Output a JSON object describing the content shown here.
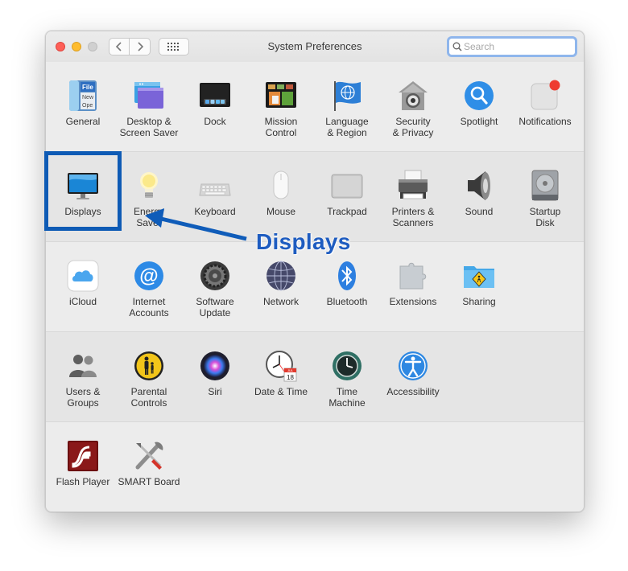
{
  "window": {
    "title": "System Preferences",
    "search_placeholder": "Search"
  },
  "annotation": {
    "label": "Displays",
    "color": "#1e5cc0"
  },
  "sections": [
    [
      {
        "name": "general",
        "label": "General",
        "icon": "general-icon"
      },
      {
        "name": "desktop-screen-saver",
        "label": "Desktop &\nScreen Saver",
        "icon": "desktop-icon"
      },
      {
        "name": "dock",
        "label": "Dock",
        "icon": "dock-icon"
      },
      {
        "name": "mission-control",
        "label": "Mission\nControl",
        "icon": "mission-control-icon"
      },
      {
        "name": "language-region",
        "label": "Language\n& Region",
        "icon": "flag-icon"
      },
      {
        "name": "security-privacy",
        "label": "Security\n& Privacy",
        "icon": "house-lock-icon"
      },
      {
        "name": "spotlight",
        "label": "Spotlight",
        "icon": "magnifier-icon"
      },
      {
        "name": "notifications",
        "label": "Notifications",
        "icon": "notifications-icon"
      }
    ],
    [
      {
        "name": "displays",
        "label": "Displays",
        "icon": "monitor-icon"
      },
      {
        "name": "energy-saver",
        "label": "Energy\nSaver",
        "icon": "lightbulb-icon"
      },
      {
        "name": "keyboard",
        "label": "Keyboard",
        "icon": "keyboard-icon"
      },
      {
        "name": "mouse",
        "label": "Mouse",
        "icon": "mouse-icon"
      },
      {
        "name": "trackpad",
        "label": "Trackpad",
        "icon": "trackpad-icon"
      },
      {
        "name": "printers-scanners",
        "label": "Printers &\nScanners",
        "icon": "printer-icon"
      },
      {
        "name": "sound",
        "label": "Sound",
        "icon": "speaker-icon"
      },
      {
        "name": "startup-disk",
        "label": "Startup\nDisk",
        "icon": "disk-icon"
      }
    ],
    [
      {
        "name": "icloud",
        "label": "iCloud",
        "icon": "cloud-icon"
      },
      {
        "name": "internet-accounts",
        "label": "Internet\nAccounts",
        "icon": "at-sign-icon"
      },
      {
        "name": "software-update",
        "label": "Software\nUpdate",
        "icon": "gear-icon"
      },
      {
        "name": "network",
        "label": "Network",
        "icon": "globe-icon"
      },
      {
        "name": "bluetooth",
        "label": "Bluetooth",
        "icon": "bluetooth-icon"
      },
      {
        "name": "extensions",
        "label": "Extensions",
        "icon": "puzzle-icon"
      },
      {
        "name": "sharing",
        "label": "Sharing",
        "icon": "sharing-folder-icon"
      }
    ],
    [
      {
        "name": "users-groups",
        "label": "Users &\nGroups",
        "icon": "users-icon"
      },
      {
        "name": "parental-controls",
        "label": "Parental\nControls",
        "icon": "parental-icon"
      },
      {
        "name": "siri",
        "label": "Siri",
        "icon": "siri-icon"
      },
      {
        "name": "date-time",
        "label": "Date & Time",
        "icon": "clock-calendar-icon"
      },
      {
        "name": "time-machine",
        "label": "Time\nMachine",
        "icon": "time-machine-icon"
      },
      {
        "name": "accessibility",
        "label": "Accessibility",
        "icon": "accessibility-icon"
      }
    ],
    [
      {
        "name": "flash-player",
        "label": "Flash Player",
        "icon": "flash-icon"
      },
      {
        "name": "smart-board",
        "label": "SMART Board",
        "icon": "tools-icon"
      }
    ]
  ],
  "calendar_icon": {
    "month": "JUL",
    "day": "18"
  },
  "general_icon_text": {
    "line1": "File",
    "line2": "New",
    "line3": "Ope"
  }
}
